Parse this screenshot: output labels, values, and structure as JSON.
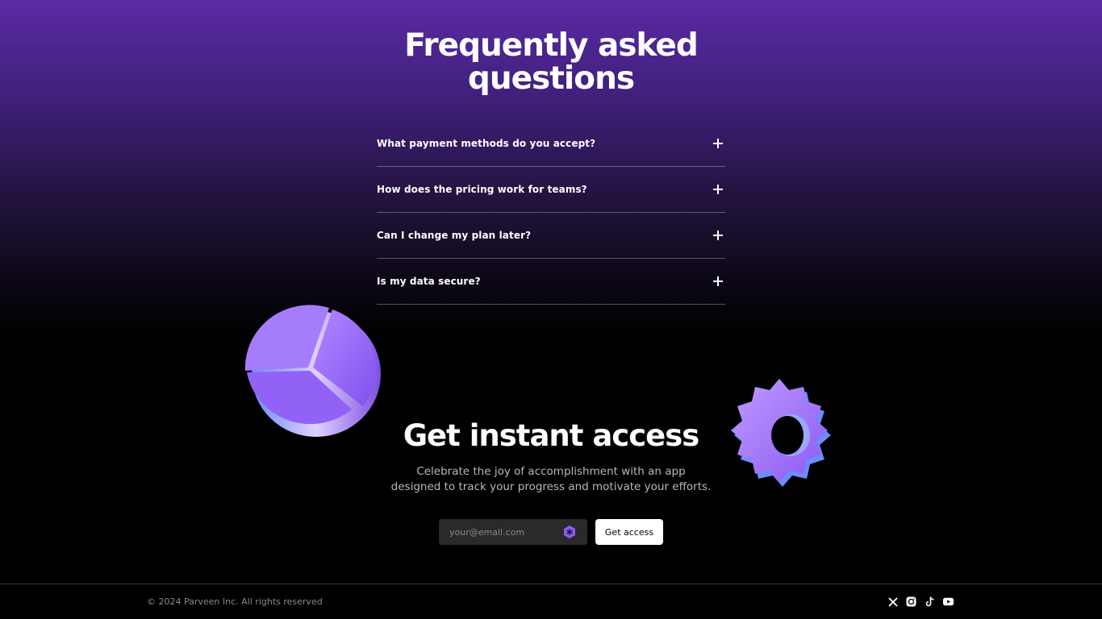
{
  "faq": {
    "title_line1": "Frequently asked",
    "title_line2": "questions",
    "items": [
      {
        "question": "What payment methods do you accept?",
        "icon": "plus-icon"
      },
      {
        "question": "How does the pricing work for teams?",
        "icon": "plus-icon"
      },
      {
        "question": "Can I change my plan later?",
        "icon": "plus-icon"
      },
      {
        "question": "Is my data secure?",
        "icon": "plus-icon"
      }
    ]
  },
  "cta": {
    "title": "Get instant access",
    "subtitle_line1": "Celebrate the joy of accomplishment with an app",
    "subtitle_line2": "designed to track your progress and motivate your efforts.",
    "email_placeholder": "your@email.com",
    "button_label": "Get access"
  },
  "footer": {
    "copyright": "© 2024 Parveen Inc. All rights reserved",
    "socials": [
      "x-icon",
      "instagram-icon",
      "tiktok-icon",
      "youtube-icon"
    ]
  },
  "colors": {
    "accent": "#8b5cf6",
    "bg_top": "#5a2aa3",
    "bg_bottom": "#000000"
  }
}
